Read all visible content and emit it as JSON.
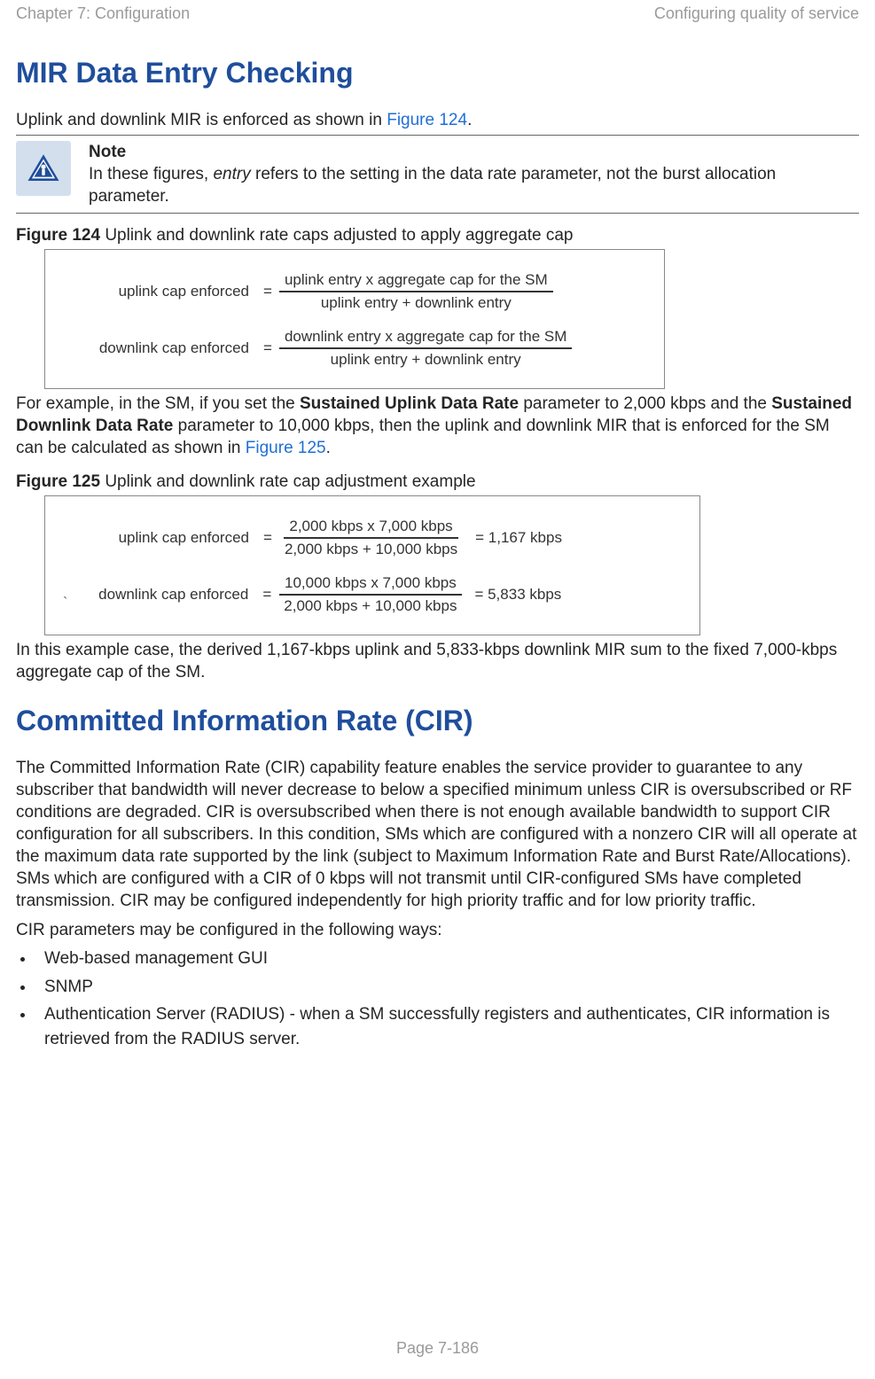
{
  "header": {
    "left": "Chapter 7:  Configuration",
    "right": "Configuring quality of service"
  },
  "section1": {
    "title": "MIR Data Entry Checking",
    "intro_pre": "Uplink and downlink MIR is enforced as shown in ",
    "intro_link": "Figure 124",
    "intro_post": ".",
    "note_label": "Note",
    "note_text_pre": "In these figures, ",
    "note_text_em": "entry",
    "note_text_post": " refers to the setting in the data rate parameter, not the burst allocation parameter."
  },
  "figure124": {
    "label": "Figure 124",
    "caption": " Uplink and downlink rate caps adjusted to apply aggregate cap",
    "row1": {
      "lhs": "uplink cap  enforced",
      "num": "uplink entry  x  aggregate cap for the SM",
      "den": "uplink entry  +   downlink entry"
    },
    "row2": {
      "lhs": "downlink cap enforced",
      "num": "downlink entry  x  aggregate cap for the SM",
      "den": "uplink entry  +   downlink entry"
    }
  },
  "para1_pre": "For example, in the SM, if you set the ",
  "para1_b1": "Sustained Uplink Data Rate",
  "para1_mid1": " parameter to 2,000 kbps and the ",
  "para1_b2": "Sustained Downlink Data Rate",
  "para1_mid2": " parameter to 10,000 kbps, then the uplink and downlink MIR that is enforced for the SM can be calculated as shown in ",
  "para1_link": "Figure 125",
  "para1_post": ".",
  "figure125": {
    "label": "Figure 125",
    "caption": " Uplink and downlink rate cap adjustment example",
    "row1": {
      "lhs": "uplink cap enforced",
      "num": "2,000 kbps  x  7,000 kbps",
      "den": "2,000 kbps  +   10,000 kbps",
      "result": "=   1,167 kbps"
    },
    "row2": {
      "lhs": "downlink cap enforced",
      "num": "10,000 kbps  x  7,000 kbps",
      "den": "2,000 kbps  +   10,000 kbps",
      "result": "=    5,833 kbps"
    }
  },
  "para2": "In this example case, the derived 1,167-kbps uplink and 5,833-kbps downlink MIR sum to the fixed 7,000-kbps aggregate cap of the SM.",
  "section2": {
    "title": "Committed Information Rate (CIR)",
    "para1": "The Committed Information Rate (CIR) capability feature enables the service provider to guarantee to any subscriber that bandwidth will never decrease to below a specified minimum unless CIR is oversubscribed or RF conditions are degraded. CIR is oversubscribed when there is not enough available bandwidth to support CIR configuration for all subscribers. In this condition, SMs which are configured with a nonzero CIR will all operate at the maximum data rate supported by the link (subject to Maximum Information Rate and Burst Rate/Allocations). SMs which are configured with a CIR of 0 kbps will not transmit until CIR-configured SMs have completed transmission. CIR may be configured independently for high priority traffic and for low priority traffic.",
    "para2": "CIR parameters may be configured in the following ways:",
    "bullets": [
      "Web-based management GUI",
      "SNMP",
      "Authentication Server (RADIUS) - when a SM successfully registers and authenticates, CIR information is retrieved from the RADIUS server."
    ]
  },
  "footer": "Page 7-186"
}
